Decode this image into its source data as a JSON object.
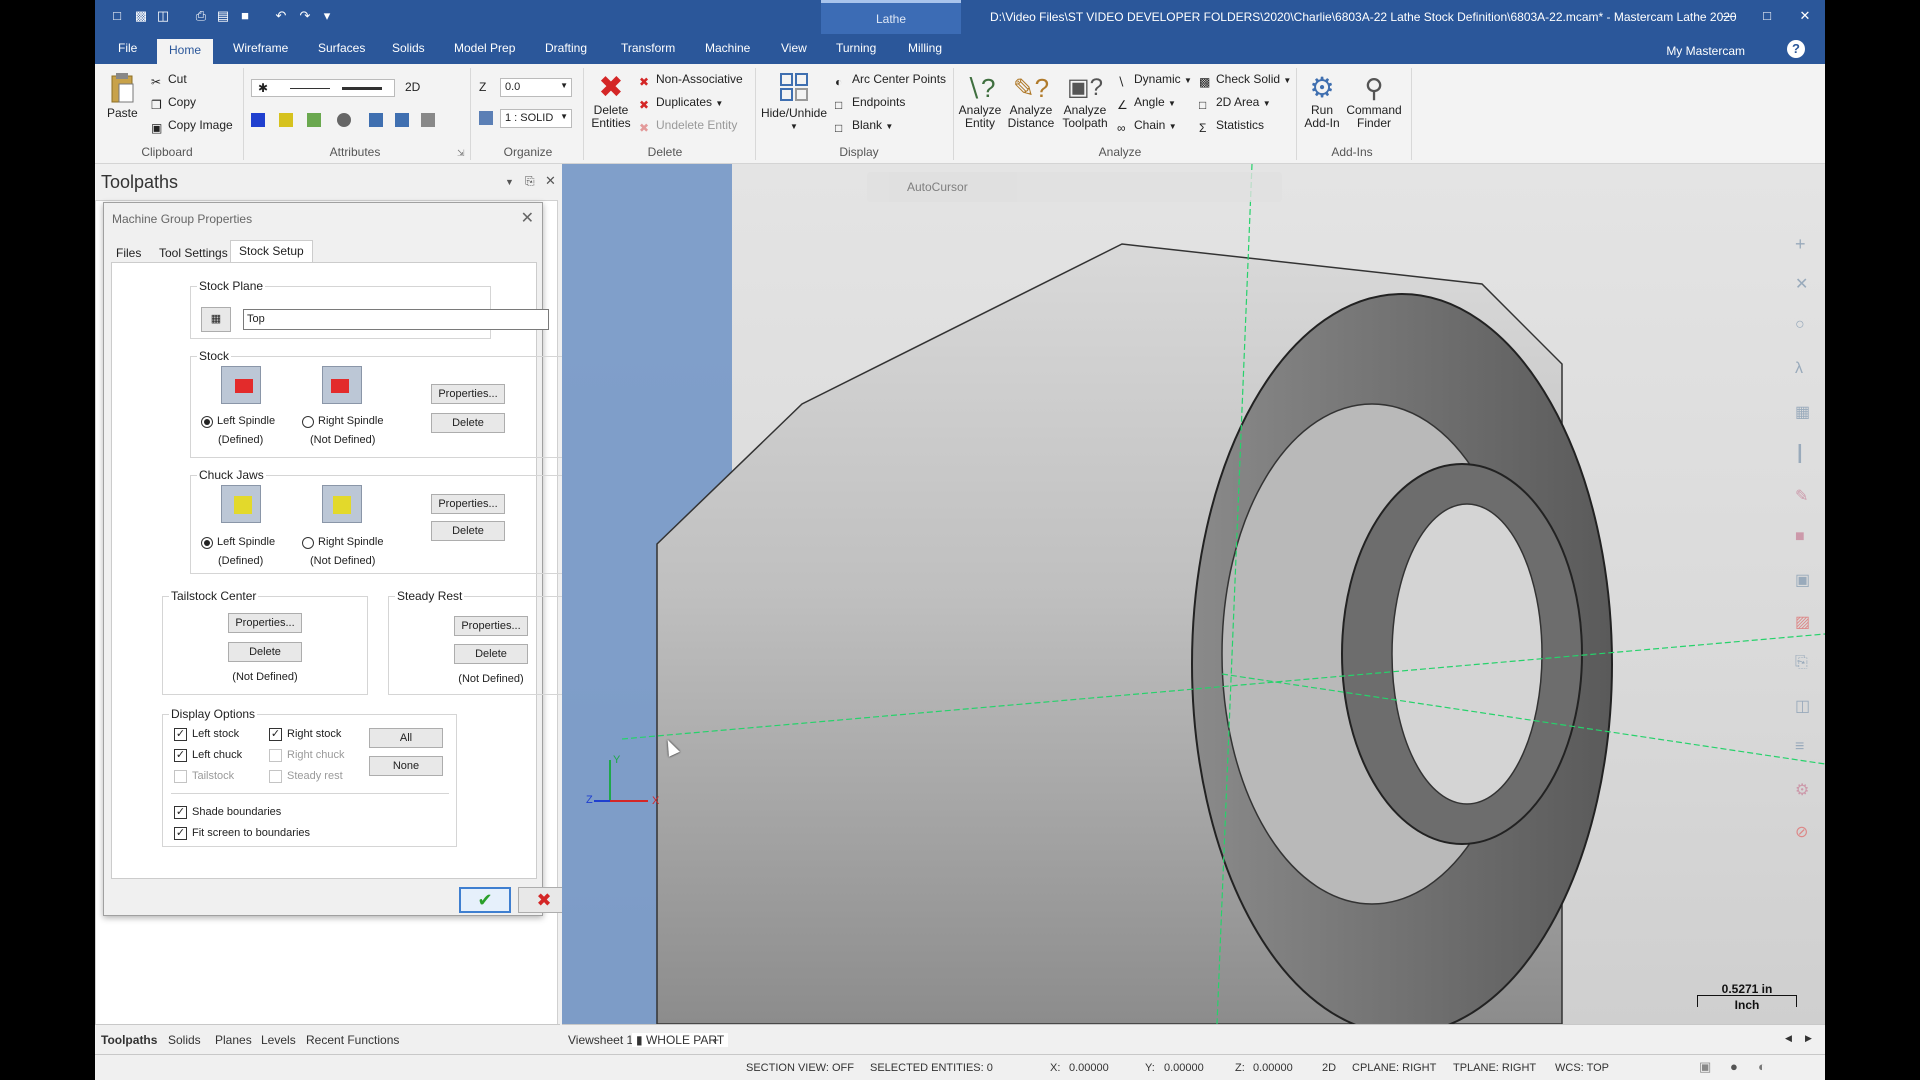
{
  "titlebar": {
    "contextual_tab": "Lathe",
    "title": "D:\\Video Files\\ST VIDEO DEVELOPER FOLDERS\\2020\\Charlie\\6803A-22 Lathe Stock Definition\\6803A-22.mcam* - Mastercam Lathe 2020"
  },
  "ribbon_tabs": [
    "File",
    "Home",
    "Wireframe",
    "Surfaces",
    "Solids",
    "Model Prep",
    "Drafting",
    "Transform",
    "Machine",
    "View",
    "Turning",
    "Milling"
  ],
  "my_mastercam": "My Mastercam",
  "ribbon": {
    "clipboard": {
      "label": "Clipboard",
      "paste": "Paste",
      "cut": "Cut",
      "copy": "Copy",
      "copy_image": "Copy Image"
    },
    "attributes": {
      "label": "Attributes",
      "mode": "2D"
    },
    "organize": {
      "label": "Organize",
      "z_label": "Z",
      "z_value": "0.0",
      "level_value": "1 : SOLID"
    },
    "delete": {
      "label": "Delete",
      "delete_entities": "Delete\nEntities",
      "non_associative": "Non-Associative",
      "duplicates": "Duplicates",
      "undelete_entity": "Undelete Entity"
    },
    "display": {
      "label": "Display",
      "hide_unhide": "Hide/Unhide",
      "arc_center_points": "Arc Center Points",
      "endpoints": "Endpoints",
      "blank": "Blank"
    },
    "analyze": {
      "label": "Analyze",
      "analyze_entity": "Analyze\nEntity",
      "analyze_distance": "Analyze\nDistance",
      "analyze_toolpath": "Analyze\nToolpath",
      "dynamic": "Dynamic",
      "angle": "Angle",
      "chain": "Chain",
      "check_solid": "Check Solid",
      "area_2d": "2D Area",
      "statistics": "Statistics"
    },
    "addins": {
      "label": "Add-Ins",
      "run_addin": "Run\nAdd-In",
      "command_finder": "Command\nFinder"
    }
  },
  "manager": {
    "title": "Toolpaths",
    "bottom_tabs": [
      "Toolpaths",
      "Solids",
      "Planes",
      "Levels",
      "Recent Functions"
    ]
  },
  "dialog": {
    "title": "Machine Group Properties",
    "tabs": [
      "Files",
      "Tool Settings",
      "Stock Setup"
    ],
    "stock_plane": {
      "label": "Stock Plane",
      "value": "Top"
    },
    "stock": {
      "label": "Stock",
      "left_spindle": "Left Spindle",
      "left_state": "(Defined)",
      "right_spindle": "Right Spindle",
      "right_state": "(Not Defined)",
      "properties": "Properties...",
      "delete": "Delete"
    },
    "chuck_jaws": {
      "label": "Chuck Jaws",
      "left_spindle": "Left Spindle",
      "left_state": "(Defined)",
      "right_spindle": "Right Spindle",
      "right_state": "(Not Defined)",
      "properties": "Properties...",
      "delete": "Delete"
    },
    "tailstock": {
      "label": "Tailstock Center",
      "properties": "Properties...",
      "delete": "Delete",
      "state": "(Not Defined)"
    },
    "steady_rest": {
      "label": "Steady Rest",
      "properties": "Properties...",
      "delete": "Delete",
      "state": "(Not Defined)"
    },
    "display_options": {
      "label": "Display Options",
      "left_stock": "Left stock",
      "right_stock": "Right stock",
      "left_chuck": "Left chuck",
      "right_chuck": "Right chuck",
      "tailstock": "Tailstock",
      "steady_rest": "Steady rest",
      "all": "All",
      "none": "None",
      "shade_boundaries": "Shade boundaries",
      "fit_screen": "Fit screen to boundaries"
    }
  },
  "viewport": {
    "autocursor": "AutoCursor",
    "scale_value": "0.5271 in",
    "scale_unit": "Inch",
    "axis_z": "Z",
    "axis_x": "X",
    "axis_y": "Y",
    "viewsheet": "Viewsheet 1",
    "whole_part": "WHOLE PART",
    "plus": "+"
  },
  "status": {
    "section_view": "SECTION VIEW: OFF",
    "selected": "SELECTED ENTITIES: 0",
    "x_label": "X:",
    "x_value": "0.00000",
    "y_label": "Y:",
    "y_value": "0.00000",
    "z_label": "Z:",
    "z_value": "0.00000",
    "mode": "2D",
    "cplane": "CPLANE: RIGHT",
    "tplane": "TPLANE: RIGHT",
    "wcs": "WCS: TOP"
  },
  "colors": {
    "accent": "#2b579a",
    "axis_green": "#26d26b",
    "delete_red": "#d42626",
    "ok_green": "#2aa02a"
  }
}
